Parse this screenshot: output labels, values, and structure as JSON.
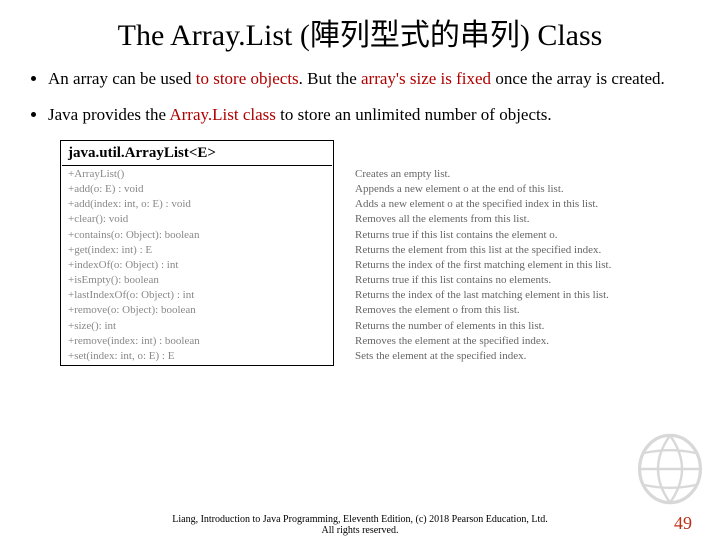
{
  "title_a": "The Array.List ",
  "title_b": "(陣列型式的串列)",
  "title_c": " Class",
  "bullet1_a": "An array can be used ",
  "bullet1_b": "to store objects",
  "bullet1_c": ". But the ",
  "bullet1_d": "array's size is fixed",
  "bullet1_e": " once the array is created.",
  "bullet2_a": "Java provides the ",
  "bullet2_b": "Array.List class",
  "bullet2_c": " to store an unlimited number of objects.",
  "class_name": "java.util.ArrayList<E>",
  "rows": [
    {
      "m": "+ArrayList()",
      "d": "Creates an empty list."
    },
    {
      "m": "+add(o: E) : void",
      "d": "Appends a new element o at the end of this list."
    },
    {
      "m": "+add(index: int, o: E) : void",
      "d": "Adds a new element o at the specified index in this list."
    },
    {
      "m": "+clear(): void",
      "d": "Removes all the elements from this list."
    },
    {
      "m": "+contains(o: Object): boolean",
      "d": "Returns true if this list contains the element o."
    },
    {
      "m": "+get(index: int) : E",
      "d": "Returns the element from this list at the specified index."
    },
    {
      "m": "+indexOf(o: Object) : int",
      "d": "Returns the index of the first matching element in this list."
    },
    {
      "m": "+isEmpty(): boolean",
      "d": "Returns true if this list contains no elements."
    },
    {
      "m": "+lastIndexOf(o: Object) : int",
      "d": "Returns the index of the last matching element in this list."
    },
    {
      "m": "+remove(o: Object): boolean",
      "d": "Removes the element o from this list."
    },
    {
      "m": "+size(): int",
      "d": "Returns the number of elements in this list."
    },
    {
      "m": "+remove(index: int) : boolean",
      "d": "Removes the element at the specified index."
    },
    {
      "m": "+set(index: int, o: E) : E",
      "d": "Sets the element at the specified index."
    }
  ],
  "footer_line1": "Liang, Introduction to Java Programming, Eleventh Edition, (c) 2018 Pearson Education, Ltd.",
  "footer_line2": "All rights reserved.",
  "page_number": "49"
}
